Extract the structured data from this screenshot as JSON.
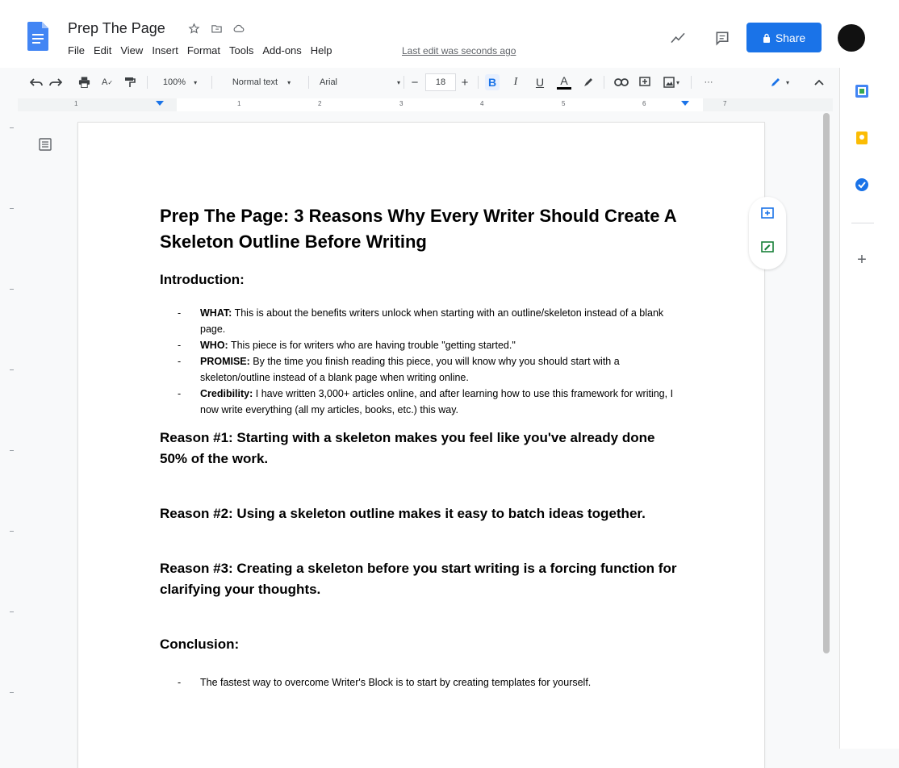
{
  "header": {
    "title": "Prep The Page",
    "last_edit": "Last edit was seconds ago",
    "share_label": "Share",
    "menu": [
      "File",
      "Edit",
      "View",
      "Insert",
      "Format",
      "Tools",
      "Add-ons",
      "Help"
    ]
  },
  "toolbar": {
    "zoom": "100%",
    "style": "Normal text",
    "font": "Arial",
    "font_size": "18",
    "more": "···"
  },
  "ruler": {
    "labels": [
      "1",
      "1",
      "2",
      "3",
      "4",
      "5",
      "6",
      "7"
    ]
  },
  "doc": {
    "title": "Prep The Page: 3 Reasons Why Every Writer Should Create A Skeleton Outline Before Writing",
    "intro_heading": "Introduction:",
    "intro": [
      {
        "label": "WHAT:",
        "text": " This is about the benefits writers unlock when starting with an outline/skeleton instead of a blank page."
      },
      {
        "label": "WHO:",
        "text": " This piece is for writers who are having trouble \"getting started.\""
      },
      {
        "label": "PROMISE:",
        "text": " By the time you finish reading this piece, you will know why you should start with a skeleton/outline instead of a blank page when writing online."
      },
      {
        "label": "Credibility:",
        "text": " I have written 3,000+ articles online, and after learning how to use this framework for writing, I now write everything (all my articles, books, etc.) this way."
      }
    ],
    "reason1": "Reason #1: Starting with a skeleton makes you feel like you've already done 50% of the work.",
    "reason2": "Reason #2: Using a skeleton outline makes it easy to batch ideas together.",
    "reason3": "Reason #3: Creating a skeleton before you start writing is a forcing function for clarifying your thoughts.",
    "conclusion_heading": "Conclusion:",
    "conclusion": [
      "The fastest way to overcome Writer's Block is to start by creating templates for yourself."
    ]
  },
  "side_panel": {
    "add": "+"
  }
}
